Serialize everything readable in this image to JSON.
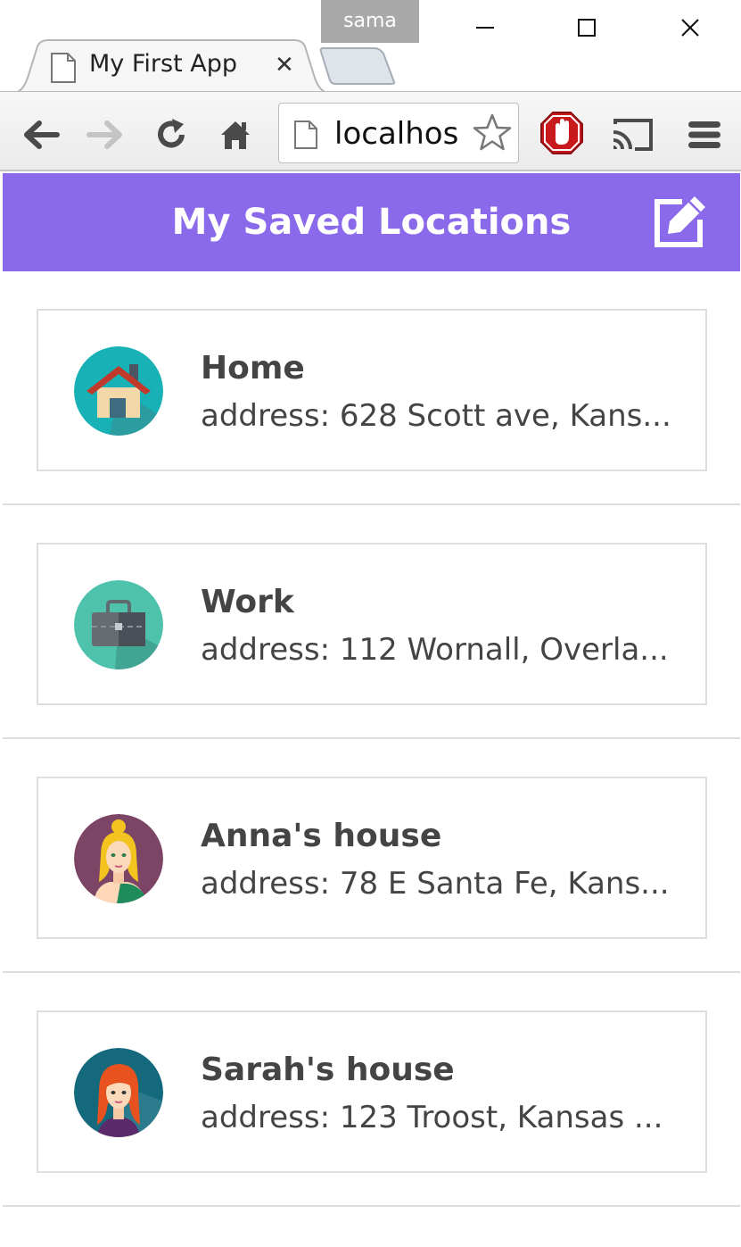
{
  "window": {
    "profile_name": "sama",
    "tab_title": "My First App",
    "tab_close_glyph": "✕",
    "address_bar_text": "localhos"
  },
  "icons": {
    "back": "arrow-left-icon",
    "forward": "arrow-right-icon",
    "reload": "reload-icon",
    "home": "home-icon",
    "bookmark": "star-icon",
    "adblock": "stop-hand-icon",
    "cast": "cast-icon",
    "menu": "hamburger-icon",
    "edit": "edit-icon"
  },
  "colors": {
    "header_bg": "#8a69ea",
    "text": "#444444",
    "card_border": "#dedede"
  },
  "app": {
    "title": "My Saved Locations",
    "locations": [
      {
        "name": "Home",
        "address": "address: 628 Scott ave, Kans...",
        "avatar": "house-avatar"
      },
      {
        "name": "Work",
        "address": "address: 112 Wornall, Overla...",
        "avatar": "briefcase-avatar"
      },
      {
        "name": "Anna's house",
        "address": "address: 78 E Santa Fe, Kans...",
        "avatar": "blonde-woman-avatar"
      },
      {
        "name": "Sarah's house",
        "address": "address: 123 Troost, Kansas ...",
        "avatar": "redhead-woman-avatar"
      }
    ]
  }
}
